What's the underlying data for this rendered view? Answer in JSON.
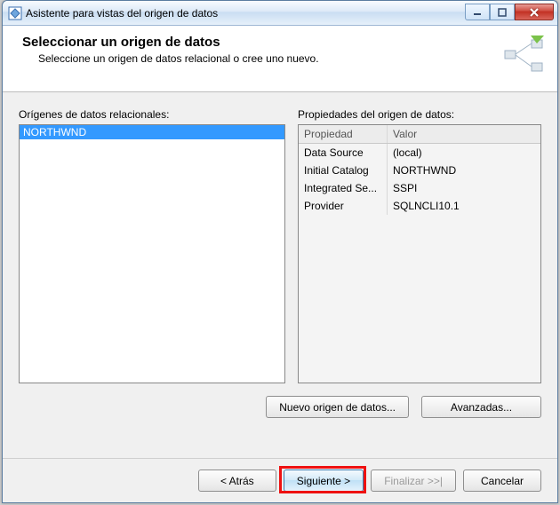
{
  "window": {
    "title": "Asistente para vistas del origen de datos"
  },
  "header": {
    "title": "Seleccionar un origen de datos",
    "subtitle": "Seleccione un origen de datos relacional o cree uno nuevo."
  },
  "labels": {
    "sources_list": "Orígenes de datos relacionales:",
    "properties": "Propiedades del origen de datos:"
  },
  "sources": {
    "items": [
      "NORTHWND"
    ],
    "selected_index": 0
  },
  "property_grid": {
    "header_name": "Propiedad",
    "header_value": "Valor",
    "rows": [
      {
        "name": "Data Source",
        "value": "(local)"
      },
      {
        "name": "Initial Catalog",
        "value": "NORTHWND"
      },
      {
        "name": "Integrated Se...",
        "value": "SSPI"
      },
      {
        "name": "Provider",
        "value": "SQLNCLI10.1"
      }
    ]
  },
  "buttons": {
    "new_source": "Nuevo origen de datos...",
    "advanced": "Avanzadas...",
    "back": "< Atrás",
    "next": "Siguiente >",
    "finish": "Finalizar >>|",
    "cancel": "Cancelar"
  }
}
